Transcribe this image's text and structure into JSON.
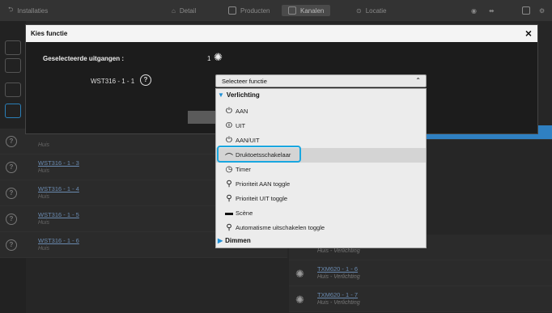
{
  "topbar": {
    "installaties": "Installaties",
    "detail": "Detail",
    "producten": "Producten",
    "kanalen": "Kanalen",
    "locatie": "Locatie"
  },
  "left_rows": [
    {
      "title": "",
      "sub": "Huis"
    },
    {
      "title": "WST316 - 1 - 3",
      "sub": "Huis"
    },
    {
      "title": "WST316 - 1 - 4",
      "sub": "Huis"
    },
    {
      "title": "WST316 - 1 - 5",
      "sub": "Huis"
    },
    {
      "title": "WST316 - 1 - 6",
      "sub": "Huis"
    }
  ],
  "right_rows": [
    {
      "title": "",
      "sub": "Huis - Verlichting"
    },
    {
      "title": "TXM620 - 1 - 6",
      "sub": "Huis - Verlichting"
    },
    {
      "title": "TXM620 - 1 - 7",
      "sub": "Huis - Verlichting"
    }
  ],
  "modal": {
    "title": "Kies functie",
    "close": "×",
    "selected_label": "Geselecteerde uitgangen :",
    "selected_count": "1",
    "output_name": "WST316 - 1 - 1",
    "help_symbol": "?"
  },
  "select": {
    "value": "Selecteer functie",
    "chevron": "⌃"
  },
  "dropdown": {
    "group_verlichting": "Verlichting",
    "group_dimmen": "Dimmen",
    "items": [
      {
        "label": "AAN",
        "icon": "power-on-icon",
        "glyph": "⏻"
      },
      {
        "label": "UIT",
        "icon": "power-off-icon",
        "glyph": "⏼"
      },
      {
        "label": "AAN/UIT",
        "icon": "power-toggle-icon",
        "glyph": "⏻"
      },
      {
        "label": "Druktoetsschakelaar",
        "icon": "pushbutton-icon",
        "glyph": "⌒"
      },
      {
        "label": "Timer",
        "icon": "timer-icon",
        "glyph": "◷"
      },
      {
        "label": "Prioriteit AAN toggle",
        "icon": "priority-on-icon",
        "glyph": "⚲"
      },
      {
        "label": "Prioriteit UIT toggle",
        "icon": "priority-off-icon",
        "glyph": "⚲"
      },
      {
        "label": "Scène",
        "icon": "scene-icon",
        "glyph": "▬"
      },
      {
        "label": "Automatisme uitschakelen toggle",
        "icon": "automation-off-icon",
        "glyph": "⚲"
      }
    ]
  },
  "colors": {
    "accent": "#19a7e0",
    "triangle": "#1e8fd6"
  }
}
